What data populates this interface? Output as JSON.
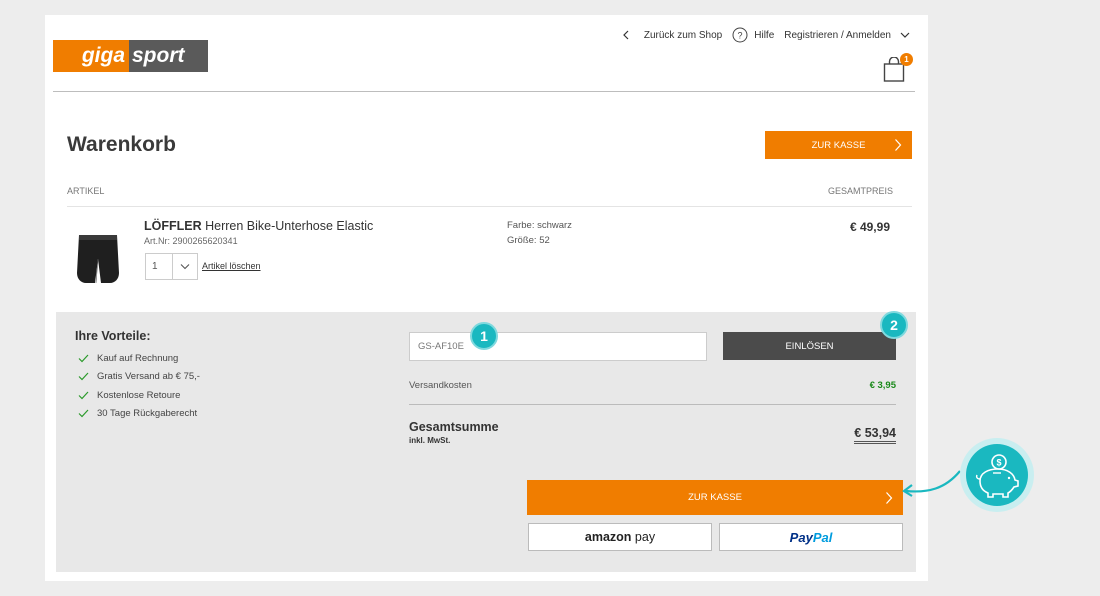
{
  "brand": {
    "logo_left": "giga",
    "logo_right": "sport",
    "orange": "#f07d00",
    "teal": "#1ab8c0"
  },
  "topnav": {
    "back": "Zurück zum Shop",
    "help": "Hilfe",
    "account": "Registrieren / Anmelden",
    "cart_count": "1"
  },
  "page": {
    "title": "Warenkorb",
    "checkout_label": "ZUR KASSE"
  },
  "table": {
    "col_article": "ARTIKEL",
    "col_total": "GESAMTPREIS"
  },
  "item": {
    "brand": "LÖFFLER",
    "name": " Herren Bike-Unterhose Elastic",
    "art_nr": "Art.Nr: 2900265620341",
    "qty": "1",
    "delete": "Artikel löschen",
    "color": "Farbe: schwarz",
    "size": "Größe: 52",
    "price": "€ 49,99"
  },
  "benefits": {
    "title": "Ihre Vorteile:",
    "items": [
      "Kauf auf Rechnung",
      "Gratis Versand ab € 75,-",
      "Kostenlose Retoure",
      "30 Tage Rückgaberecht"
    ]
  },
  "coupon": {
    "value": "GS-AF10E",
    "button": "EINLÖSEN",
    "marker1": "1",
    "marker2": "2"
  },
  "summary": {
    "shipping_label": "Versandkosten",
    "shipping_value": "€ 3,95",
    "total_label": "Gesamtsumme",
    "total_sub": "inkl. MwSt.",
    "total_value": "€ 53,94"
  },
  "payment": {
    "amazon_a": "amazon",
    "amazon_b": " pay",
    "paypal_a": "Pay",
    "paypal_b": "Pal"
  },
  "icons": [
    "chevron-left-icon",
    "help-icon",
    "chevron-down-icon",
    "shopping-bag-icon",
    "check-icon",
    "chevron-right-icon",
    "piggy-bank-icon",
    "arrow-icon"
  ]
}
